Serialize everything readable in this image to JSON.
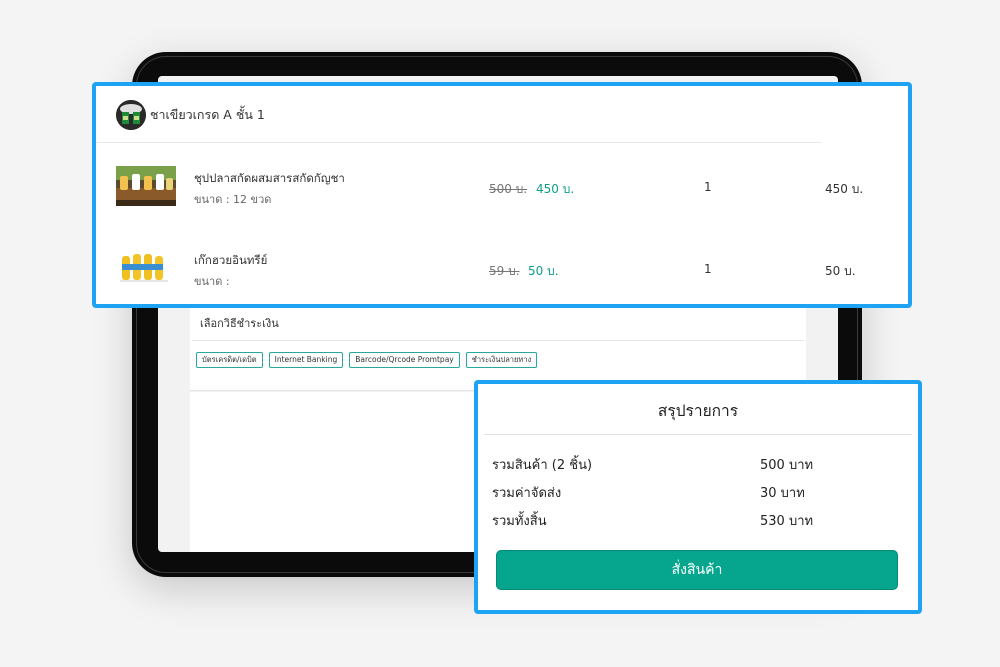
{
  "shop": {
    "name": "ชาเขียวเกรด A ชั้น 1",
    "avatar_icon": "shop-logo-icon"
  },
  "cart_items": [
    {
      "name": "ชุปปลาสกัดผสมสารสกัดกัญชา",
      "size": "ขนาด : 12 ขวด",
      "old_price": "500 บ.",
      "new_price": "450 บ.",
      "quantity": "1",
      "total": "450 บ."
    },
    {
      "name": "เก๊กฮวยอินทรีย์",
      "size": "ขนาด :",
      "old_price": "59 บ.",
      "new_price": "50 บ.",
      "quantity": "1",
      "total": "50 บ."
    }
  ],
  "payment": {
    "title": "เลือกวิธีชำระเงิน",
    "options": [
      "บัตรเครดิต/เดบิต",
      "Internet Banking",
      "Barcode/Qrcode Promtpay",
      "ชำระเงินปลายทาง"
    ]
  },
  "summary": {
    "title": "สรุปรายการ",
    "rows": [
      {
        "label": "รวมสินค้า (2 ชิ้น)",
        "value": "500 บาท"
      },
      {
        "label": "รวมค่าจัดส่ง",
        "value": "30 บาท"
      },
      {
        "label": "รวมทั้งสิ้น",
        "value": "530 บาท"
      }
    ],
    "order_button": "สั่งสินค้า"
  },
  "colors": {
    "highlight": "#1ea3f2",
    "accent": "#06a58e",
    "price": "#0f9d8c"
  }
}
